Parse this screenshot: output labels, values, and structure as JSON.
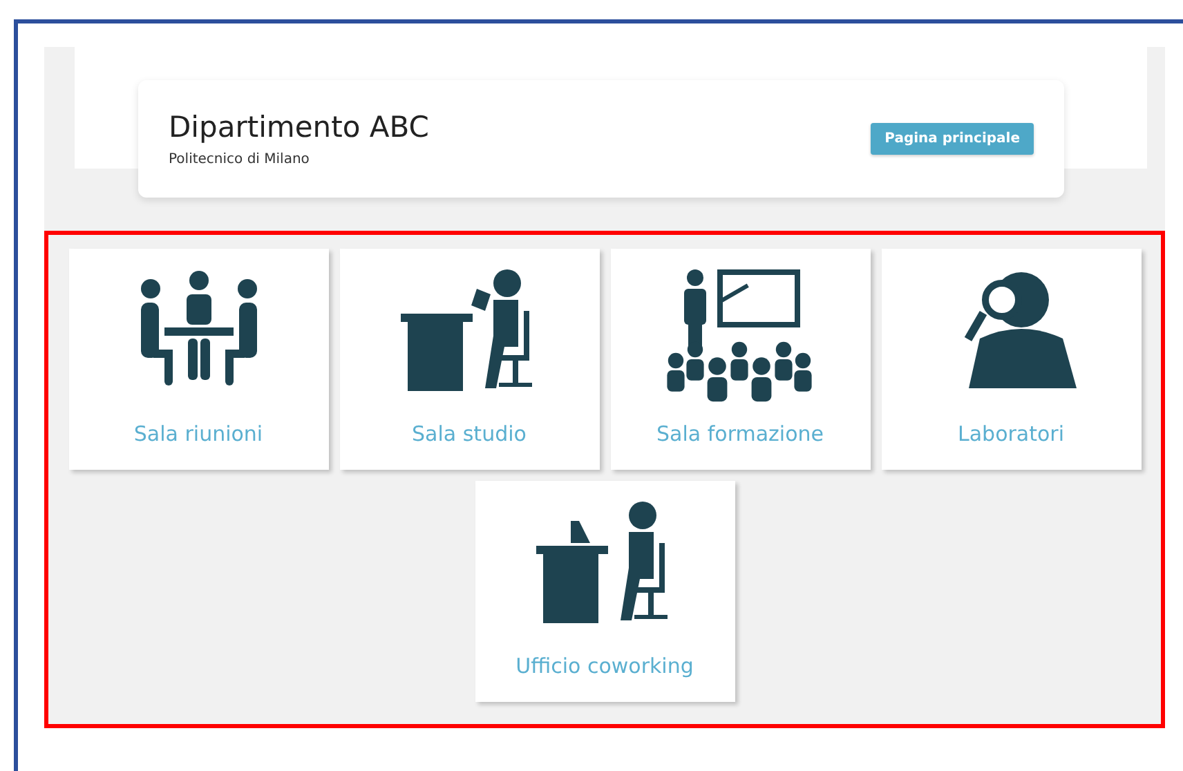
{
  "header": {
    "title": "Dipartimento ABC",
    "subtitle": "Politecnico di Milano",
    "button": "Pagina principale"
  },
  "rooms": [
    {
      "kind": "meeting",
      "label": "Sala riunioni"
    },
    {
      "kind": "study",
      "label": "Sala studio"
    },
    {
      "kind": "training",
      "label": "Sala formazione"
    },
    {
      "kind": "lab",
      "label": "Laboratori"
    },
    {
      "kind": "coworking",
      "label": "Ufficio coworking"
    }
  ]
}
